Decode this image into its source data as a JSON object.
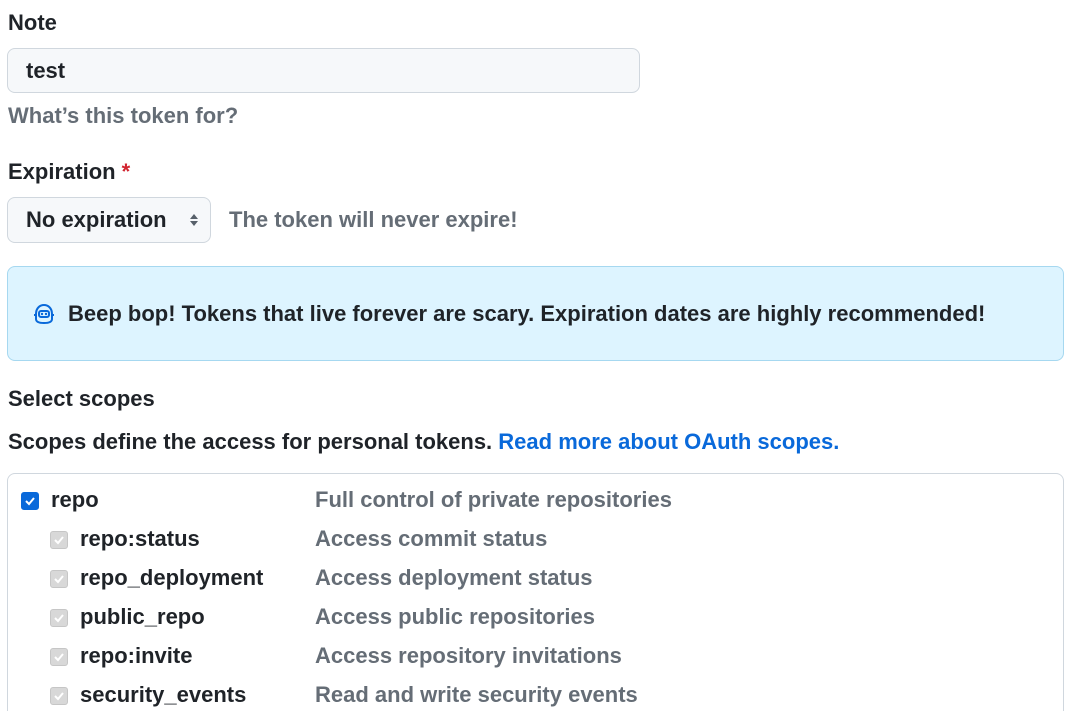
{
  "note": {
    "label": "Note",
    "value": "test",
    "hint": "What’s this token for?"
  },
  "expiration": {
    "label": "Expiration",
    "required_mark": "*",
    "selected": "No expiration",
    "hint": "The token will never expire!"
  },
  "banner": {
    "icon": "copilot-robot-icon",
    "text": "Beep bop! Tokens that live forever are scary. Expiration dates are highly recommended!"
  },
  "scopes": {
    "title": "Select scopes",
    "description": "Scopes define the access for personal tokens.",
    "link_text": "Read more about OAuth scopes.",
    "items": [
      {
        "name": "repo",
        "description": "Full control of private repositories",
        "checked": true,
        "disabled": false
      },
      {
        "name": "repo:status",
        "description": "Access commit status",
        "checked": true,
        "disabled": true
      },
      {
        "name": "repo_deployment",
        "description": "Access deployment status",
        "checked": true,
        "disabled": true
      },
      {
        "name": "public_repo",
        "description": "Access public repositories",
        "checked": true,
        "disabled": true
      },
      {
        "name": "repo:invite",
        "description": "Access repository invitations",
        "checked": true,
        "disabled": true
      },
      {
        "name": "security_events",
        "description": "Read and write security events",
        "checked": true,
        "disabled": true
      }
    ]
  },
  "colors": {
    "accent": "#0969da",
    "banner_bg": "#ddf4ff",
    "required": "#d1242f",
    "muted_text": "#656d76"
  }
}
